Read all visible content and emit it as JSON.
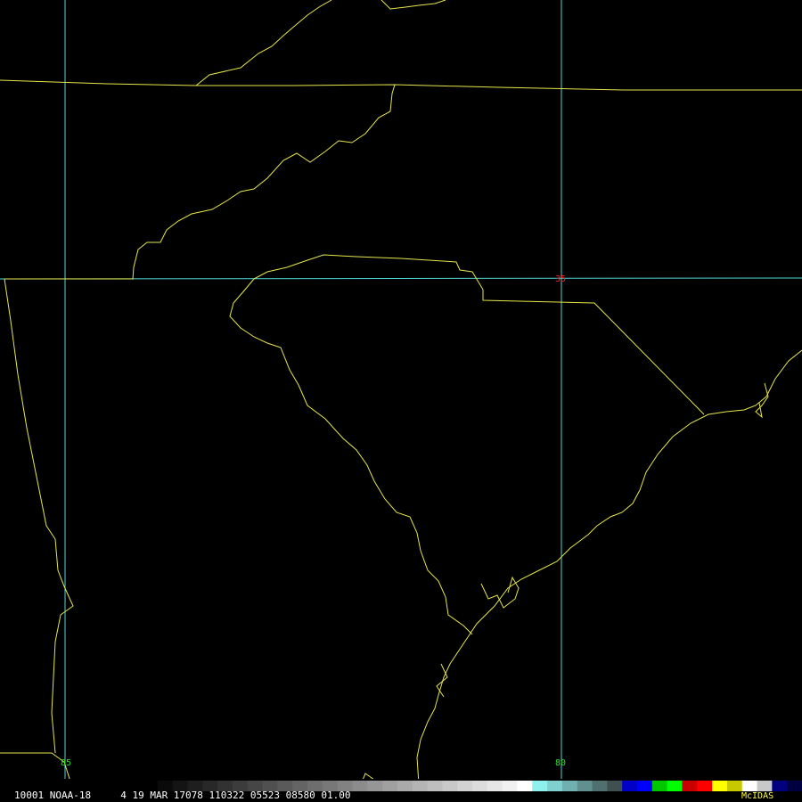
{
  "status_bar": {
    "text": "10001 NOAA-18     4 19 MAR 17078 110322 05523 08580 01.00",
    "brand": "McIDAS"
  },
  "grid": {
    "latitude_label": "35",
    "longitude_labels": [
      "85",
      "80"
    ]
  },
  "colors": {
    "background": "#000000",
    "gridlines": "#4fd6d6",
    "borders": "#e6e64a",
    "latitude_label": "#ff2020",
    "longitude_label": "#28e028",
    "status_text": "#ffffff",
    "brand": "#ffff40"
  },
  "color_bar": [
    "#000000",
    "#0a0a0a",
    "#141414",
    "#1e1e1e",
    "#282828",
    "#323232",
    "#3c3c3c",
    "#464646",
    "#505050",
    "#5a5a5a",
    "#646464",
    "#6e6e6e",
    "#787878",
    "#828282",
    "#8c8c8c",
    "#969696",
    "#a0a0a0",
    "#aaaaaa",
    "#b4b4b4",
    "#bebebe",
    "#c8c8c8",
    "#d2d2d2",
    "#dcdcdc",
    "#e6e6e6",
    "#f0f0f0",
    "#ffffff",
    "#8ff0f0",
    "#80d0d0",
    "#70b0b0",
    "#609090",
    "#507070",
    "#405050",
    "#0000c8",
    "#0000ff",
    "#00c800",
    "#00ff00",
    "#c80000",
    "#ff0000",
    "#ffff00",
    "#c8c800",
    "#ffffff",
    "#c8c8c8",
    "#000080",
    "#000040"
  ]
}
